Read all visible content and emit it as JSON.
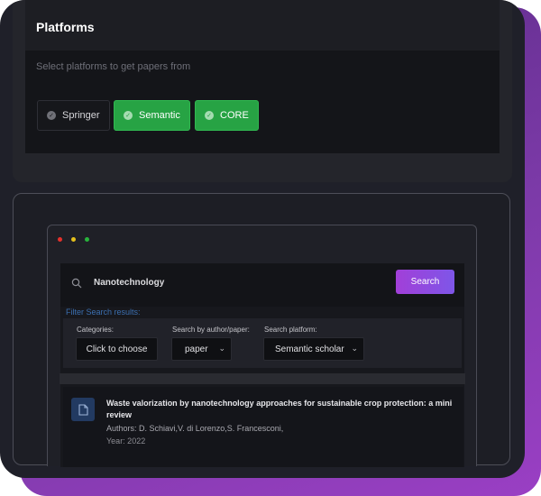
{
  "platforms": {
    "title": "Platforms",
    "hint": "Select platforms to get papers from",
    "options": [
      {
        "label": "Springer",
        "selected": false
      },
      {
        "label": "Semantic",
        "selected": true
      },
      {
        "label": "CORE",
        "selected": true
      }
    ]
  },
  "browser": {
    "window_dots": [
      "#e5312b",
      "#e4c01c",
      "#28b43c"
    ],
    "search": {
      "query": "Nanotechnology",
      "button_label": "Search"
    },
    "filter_link": "Filter Search results:",
    "filters": {
      "categories_label": "Categories:",
      "categories_value": "Click to choose",
      "author_label": "Search by author/paper:",
      "author_value": "paper",
      "platform_label": "Search platform:",
      "platform_value": "Semantic scholar"
    },
    "result": {
      "title": "Waste valorization by nanotechnology approaches for sustainable crop protection: a mini review",
      "authors": "Authors: D. Schiavi,V. di Lorenzo,S. Francesconi,",
      "year": "Year: 2022"
    }
  },
  "colors": {
    "accent_green": "#27a344",
    "accent_purple": "#a23fd8",
    "link_blue": "#3b6fb0"
  }
}
